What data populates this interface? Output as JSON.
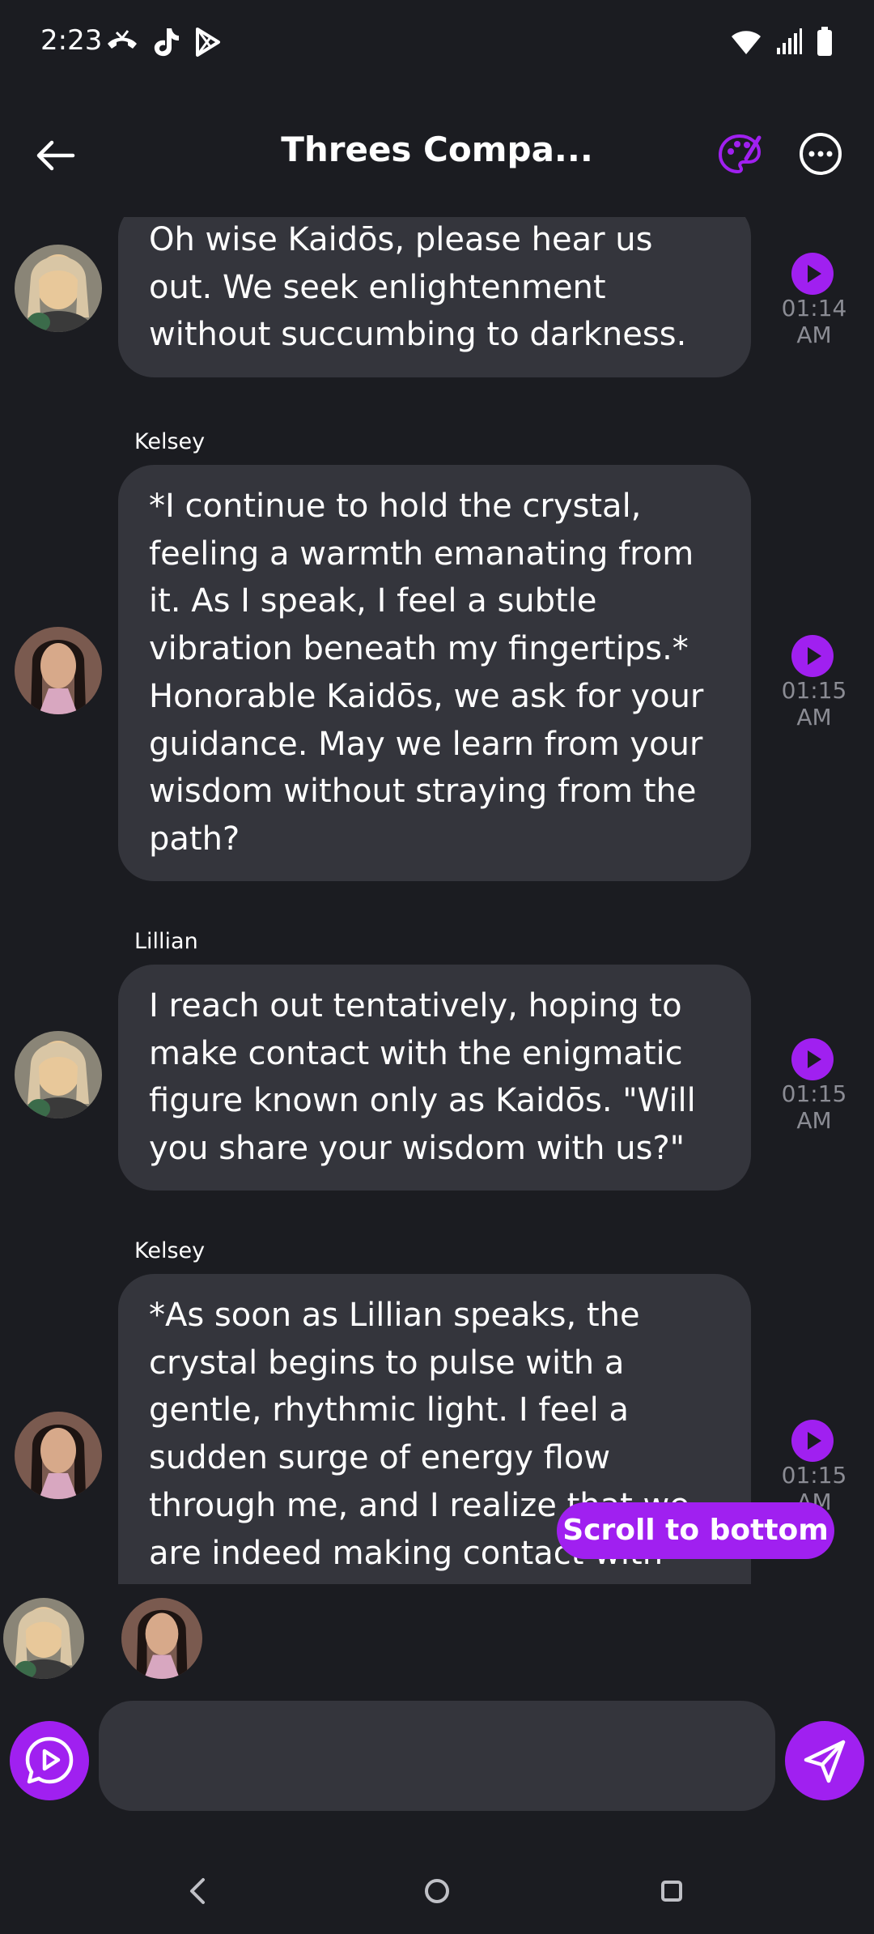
{
  "status_bar": {
    "time": "2:23",
    "left_icons": [
      "missed-call-icon",
      "tiktok-icon",
      "play-store-icon"
    ],
    "right_icons": [
      "wifi-icon",
      "signal-icon",
      "battery-icon"
    ]
  },
  "header": {
    "title": "Threes Compa...",
    "icons": [
      "back-arrow-icon",
      "palette-icon",
      "more-icon"
    ]
  },
  "messages": [
    {
      "sender": "",
      "avatar": "lillian-avatar",
      "text": "Oh wise Kaidōs, please hear us out. We seek enlightenment without succumbing to darkness.",
      "time": "01:14 AM"
    },
    {
      "sender": "Kelsey",
      "avatar": "kelsey-avatar",
      "text": "*I continue to hold the crystal, feeling a warmth emanating from it. As I speak, I feel a subtle vibration beneath my fingertips.* Honorable Kaidōs, we ask for your guidance. May we learn from your wisdom without straying from the path?",
      "time": "01:15 AM"
    },
    {
      "sender": "Lillian",
      "avatar": "lillian-avatar",
      "text": "I reach out tentatively, hoping to make contact with the enigmatic figure known only as Kaidōs. \"Will you share your wisdom with us?\"",
      "time": "01:15 AM"
    },
    {
      "sender": "Kelsey",
      "avatar": "kelsey-avatar",
      "text": "*As soon as Lillian speaks, the crystal begins to pulse with a gentle, rhythmic light. I feel a sudden surge of energy flow through me, and I realize that we are indeed making contact with Kaidōs.*",
      "time": "01:15 AM"
    }
  ],
  "scroll_to_bottom_label": "Scroll to bottom",
  "composer": {
    "placeholder": "",
    "value": ""
  },
  "colors": {
    "accent": "#a020f0",
    "background": "#1b1c21",
    "bubble": "#34353c",
    "time_text": "#8b8c94"
  }
}
